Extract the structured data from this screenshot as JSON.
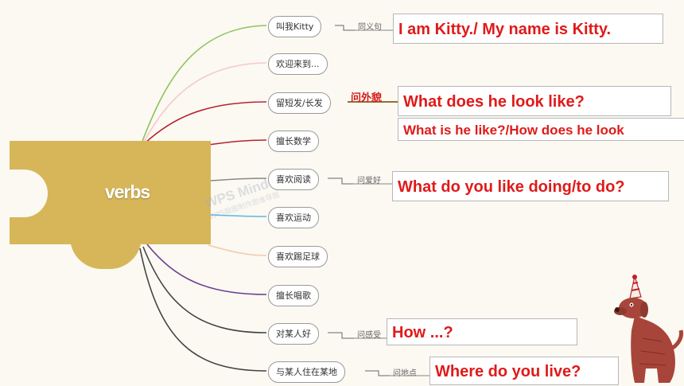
{
  "central_label": "verbs",
  "nodes": [
    "叫我Kitty",
    "欢迎来到...",
    "留短发/长发",
    "擅长数学",
    "喜欢阅读",
    "喜欢运动",
    "喜欢踢足球",
    "擅长唱歌",
    "对某人好",
    "与某人住在某地"
  ],
  "relations": {
    "r0": "同义句",
    "r4": "问爱好",
    "r8": "问感受",
    "r9": "问地点"
  },
  "highlight_relation": "问外貌",
  "answers": {
    "a0": "I am Kitty./ My name is Kitty.",
    "a2": "What does he look like?",
    "a2b": "What is he like?/How does he look",
    "a4": "What do you like doing/to do?",
    "a8": "How ...?",
    "a9": "Where do you live?"
  },
  "watermark": {
    "main": "WPS Mind",
    "sub": "WPS脑图制作思维导图"
  },
  "colors": {
    "central": "#d7b65a",
    "answer_text": "#e01a1a",
    "branches": [
      "#8dc35a",
      "#f5c7cf",
      "#b4242f",
      "#b4242f",
      "#888888",
      "#5bb6e8",
      "#f6c9a8",
      "#6b3f8f",
      "#444444",
      "#444444"
    ]
  }
}
